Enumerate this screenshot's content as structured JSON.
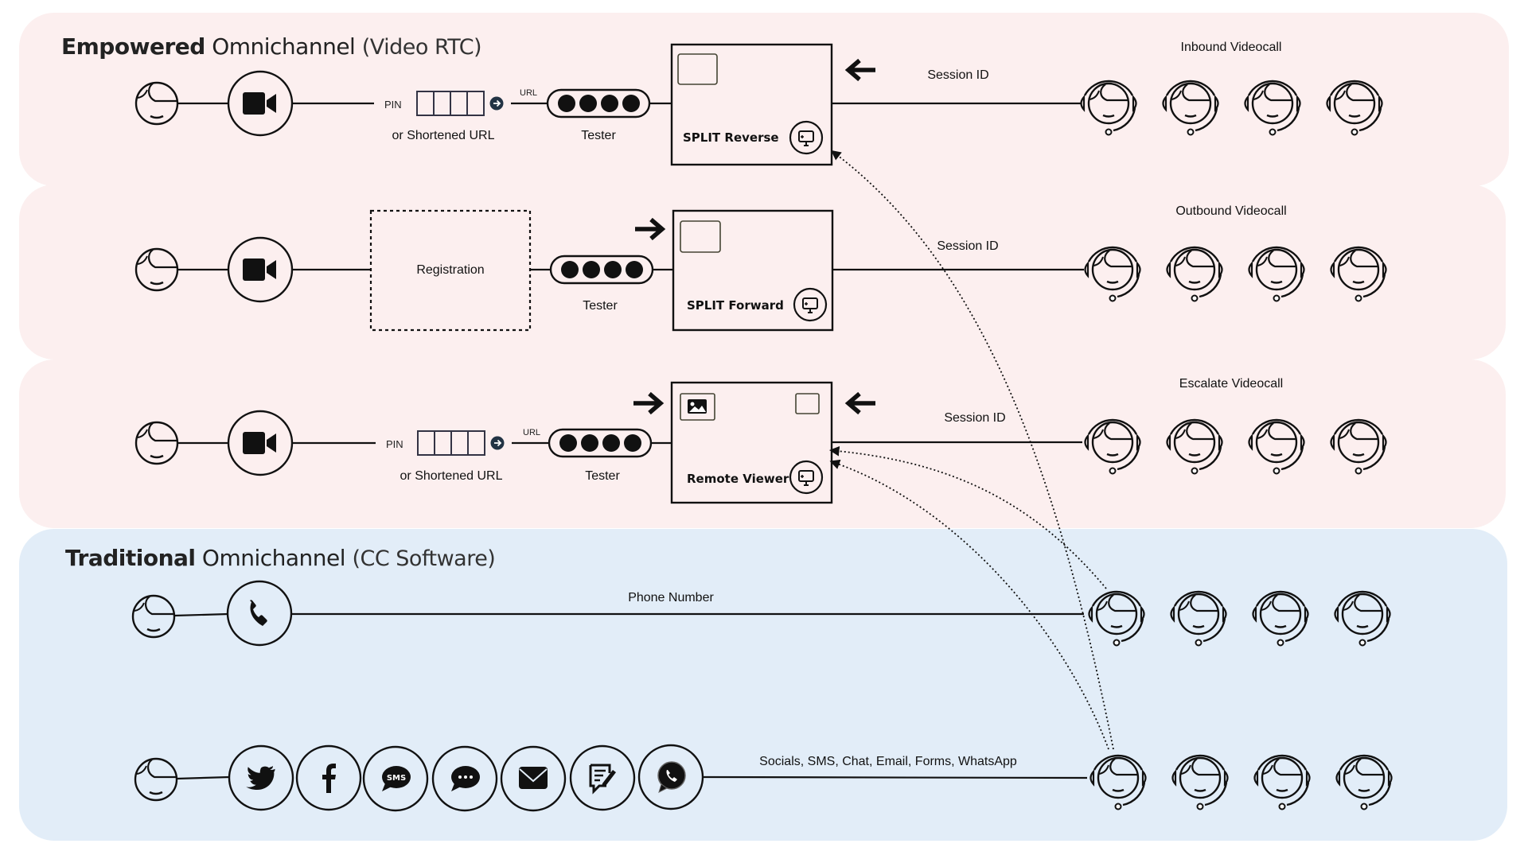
{
  "sections": {
    "empowered": {
      "title_bold": "Empowered",
      "title_mid": "Omnichannel",
      "title_light": "(Video RTC)",
      "color": "#fcefef"
    },
    "traditional": {
      "title_bold": "Traditional",
      "title_mid": "Omnichannel",
      "title_light": "(CC Software)",
      "color": "#e2edf8"
    }
  },
  "rows": {
    "inbound": {
      "channel_icon": "video-camera-icon",
      "pin_label": "PIN",
      "pin_caption": "or Shortened URL",
      "url_label": "URL",
      "tester_label": "Tester",
      "box_label": "SPLIT Reverse",
      "link_label": "Session ID",
      "group_label": "Inbound Videocall",
      "agent_count": 4
    },
    "outbound": {
      "channel_icon": "video-camera-icon",
      "registration_label": "Registration",
      "tester_label": "Tester",
      "box_label": "SPLIT Forward",
      "link_label": "Session ID",
      "group_label": "Outbound Videocall",
      "agent_count": 4
    },
    "escalate": {
      "channel_icon": "video-camera-icon",
      "pin_label": "PIN",
      "pin_caption": "or Shortened URL",
      "url_label": "URL",
      "tester_label": "Tester",
      "box_label": "Remote Viewer",
      "link_label": "Session ID",
      "group_label": "Escalate Videocall",
      "agent_count": 4
    },
    "phone": {
      "channel_icon": "phone-icon",
      "link_label": "Phone Number",
      "agent_count": 4
    },
    "digital": {
      "channel_icons": [
        "twitter-icon",
        "facebook-icon",
        "sms-icon",
        "chat-icon",
        "email-icon",
        "forms-icon",
        "whatsapp-icon"
      ],
      "sms_text": "SMS",
      "link_label": "Socials, SMS, Chat, Email, Forms, WhatsApp",
      "agent_count": 4
    }
  }
}
